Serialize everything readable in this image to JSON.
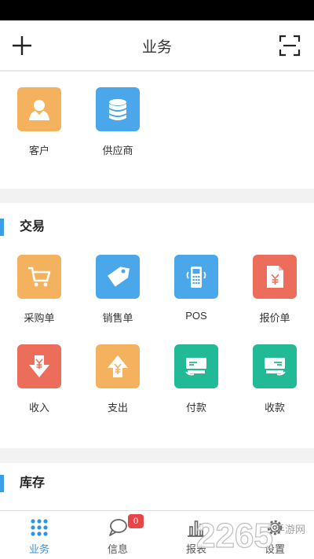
{
  "header": {
    "title": "业务"
  },
  "partners": {
    "items": [
      {
        "label": "客户",
        "icon": "person-icon",
        "color": "#f4b15e"
      },
      {
        "label": "供应商",
        "icon": "database-icon",
        "color": "#4aa7ea"
      }
    ]
  },
  "trade": {
    "title": "交易",
    "items": [
      {
        "label": "采购单",
        "icon": "cart-icon",
        "color": "#f4b15e"
      },
      {
        "label": "销售单",
        "icon": "price-tag-icon",
        "color": "#4aa7ea"
      },
      {
        "label": "POS",
        "icon": "pos-terminal-icon",
        "color": "#4aa7ea"
      },
      {
        "label": "报价单",
        "icon": "quote-document-icon",
        "color": "#ec6e5a"
      },
      {
        "label": "收入",
        "icon": "income-arrow-icon",
        "color": "#ec6e5a"
      },
      {
        "label": "支出",
        "icon": "expense-arrow-icon",
        "color": "#f4b15e"
      },
      {
        "label": "付款",
        "icon": "payment-card-icon",
        "color": "#22b996"
      },
      {
        "label": "收款",
        "icon": "receipt-card-icon",
        "color": "#22b996"
      }
    ]
  },
  "stock": {
    "title": "库存"
  },
  "tabbar": {
    "items": [
      {
        "label": "业务",
        "icon": "grid-dots-icon"
      },
      {
        "label": "信息",
        "icon": "chat-bubble-icon",
        "badge": "0"
      },
      {
        "label": "报表",
        "icon": "bar-chart-icon"
      },
      {
        "label": "设置",
        "icon": "gear-icon"
      }
    ]
  },
  "watermark": {
    "text": "2265",
    "sub": "手游网"
  },
  "colors": {
    "accent": "#3c9ee8",
    "active_tab": "#2f95e0",
    "badge": "#e84545"
  }
}
